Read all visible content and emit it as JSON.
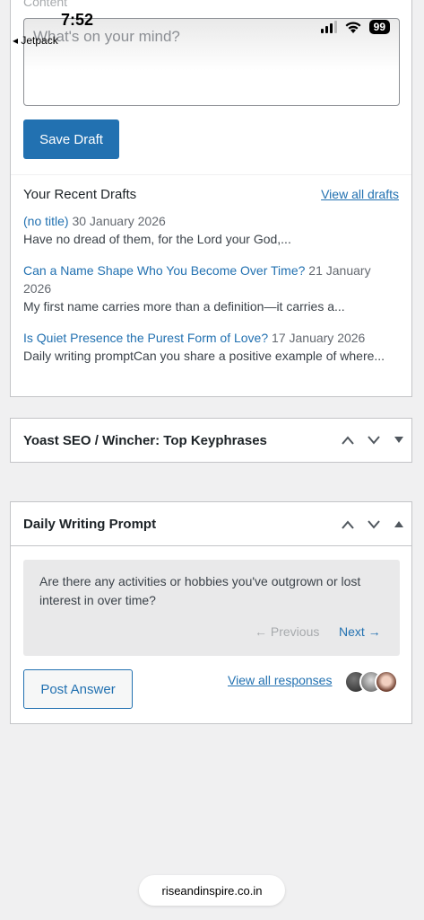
{
  "status_bar": {
    "time": "7:52",
    "back_label": "◂ Jetpack",
    "battery": "99"
  },
  "quick_draft": {
    "content_label": "Content",
    "content_placeholder": "What's on your mind?",
    "save_label": "Save Draft"
  },
  "recent_drafts": {
    "title": "Your Recent Drafts",
    "view_all": "View all drafts",
    "items": [
      {
        "title": "(no title)",
        "date": "30 January 2026",
        "excerpt": "Have no dread of them, for the Lord your God,..."
      },
      {
        "title": "Can a Name Shape Who You Become Over Time?",
        "date": "21 January 2026",
        "excerpt": "My first name carries more than a definition—it carries a..."
      },
      {
        "title": "Is Quiet Presence the Purest Form of Love?",
        "date": "17 January 2026",
        "excerpt": "Daily writing promptCan you share a positive example of where..."
      }
    ]
  },
  "yoast": {
    "title": "Yoast SEO / Wincher: Top Keyphrases"
  },
  "writing_prompt": {
    "title": "Daily Writing Prompt",
    "question": "Are there any activities or hobbies you've outgrown or lost interest in over time?",
    "previous": "← Previous",
    "next": "Next →",
    "post_answer": "Post Answer",
    "view_responses": "View all responses"
  },
  "url": "riseandinspire.co.in",
  "colors": {
    "accent": "#2271b1",
    "background": "#f0f0f1"
  }
}
